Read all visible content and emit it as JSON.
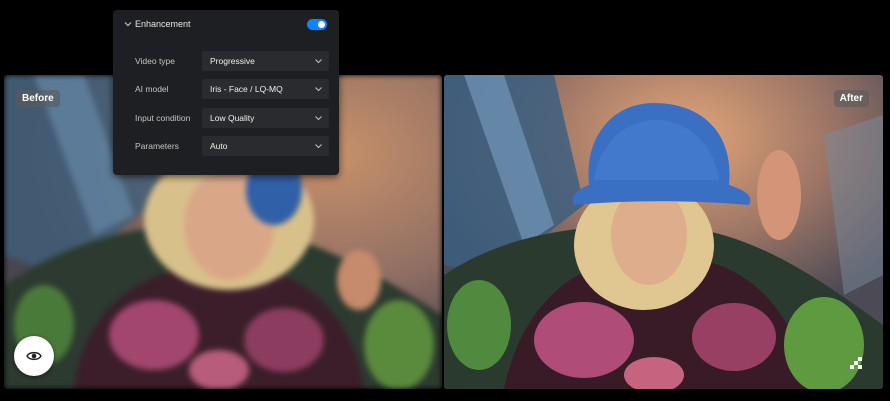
{
  "labels": {
    "before": "Before",
    "after": "After"
  },
  "panel": {
    "title": "Enhancement",
    "toggle_on": true,
    "rows": [
      {
        "label": "Video type",
        "value": "Progressive"
      },
      {
        "label": "AI model",
        "value": "Iris - Face / LQ-MQ"
      },
      {
        "label": "Input condition",
        "value": "Low Quality"
      },
      {
        "label": "Parameters",
        "value": "Auto"
      }
    ]
  },
  "icons": {
    "panel_collapse": "chevron-down-icon",
    "select_dropdown": "chevron-down-icon",
    "preview": "eye-icon",
    "compare": "checkerboard-icon"
  },
  "colors": {
    "accent": "#0a84ff",
    "panel_bg": "#1e1f22",
    "select_bg": "#2a2b2e",
    "background": "#000000"
  }
}
